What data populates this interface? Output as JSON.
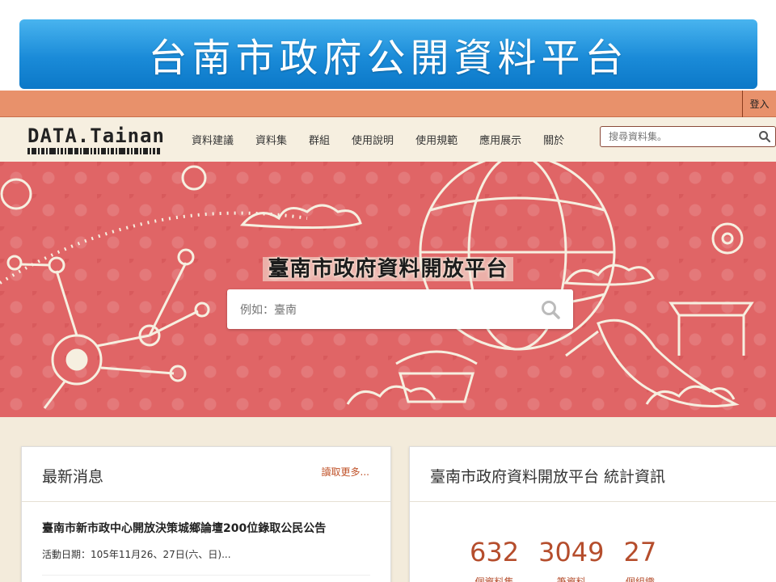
{
  "slide": {
    "title": "台南市政府公開資料平台"
  },
  "topbar": {
    "login_label": "登入"
  },
  "navbar": {
    "logo_text": "DATA.Tainan",
    "items": [
      {
        "label": "資料建議"
      },
      {
        "label": "資料集"
      },
      {
        "label": "群組"
      },
      {
        "label": "使用說明"
      },
      {
        "label": "使用規範"
      },
      {
        "label": "應用展示"
      },
      {
        "label": "關於"
      }
    ],
    "search_placeholder": "搜尋資料集。"
  },
  "hero": {
    "title": "臺南市政府資料開放平台",
    "search_placeholder": "例如：臺南"
  },
  "news": {
    "title": "最新消息",
    "read_more": "讀取更多...",
    "items": [
      {
        "title": "臺南市新市政中心開放決策城鄉論壇200位錄取公民公告",
        "date": "活動日期：105年11月26、27日(六、日)..."
      }
    ]
  },
  "stats": {
    "title": "臺南市政府資料開放平台 統計資訊",
    "items": [
      {
        "value": "632",
        "label": "個資料集"
      },
      {
        "value": "3049",
        "label": "筆資料"
      },
      {
        "value": "27",
        "label": "個組織"
      }
    ]
  },
  "colors": {
    "banner_blue": "#1a8bd8",
    "topbar_orange": "#e8916b",
    "hero_red": "#e06566",
    "accent_brown": "#b54d2c"
  }
}
